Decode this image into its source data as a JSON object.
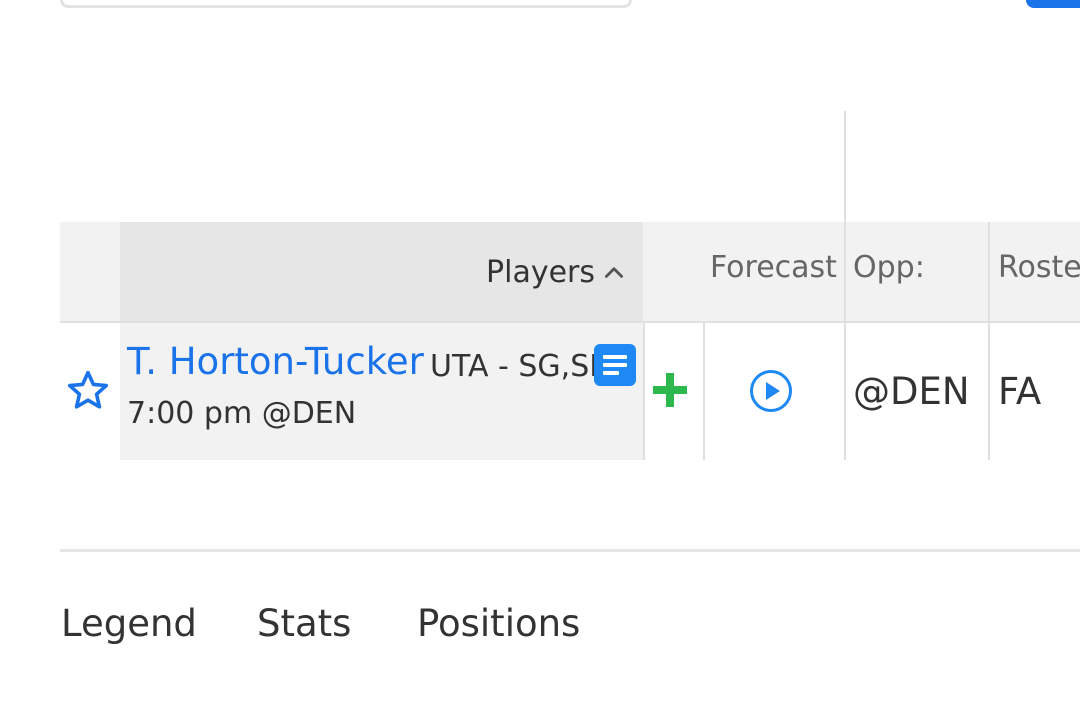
{
  "table": {
    "headers": {
      "players": "Players",
      "forecast": "Forecast",
      "opp": "Opp:",
      "roster": "Roste"
    },
    "rows": [
      {
        "name": "T. Horton-Tucker",
        "team_pos": "UTA - SG,SF",
        "game_time": "7:00 pm @DEN",
        "opp": "@DEN",
        "roster_status": "FA"
      }
    ]
  },
  "tabs": [
    {
      "label": "Legend"
    },
    {
      "label": "Stats"
    },
    {
      "label": "Positions"
    }
  ],
  "colors": {
    "accent": "#1a73e8",
    "add": "#2db84d",
    "header_bg": "#e6e6e6",
    "row_bg": "#f2f2f2"
  },
  "icons": {
    "sort": "chevron-up-icon",
    "favorite": "star-outline-icon",
    "notes": "notes-icon",
    "add": "plus-icon",
    "video": "play-circle-icon"
  }
}
